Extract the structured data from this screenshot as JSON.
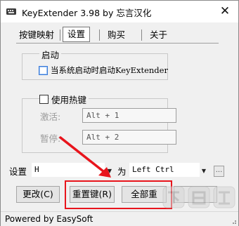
{
  "window": {
    "title": "KeyExtender 3.98 by 忘言汉化",
    "close_glyph": "✕"
  },
  "tabs": [
    {
      "label": "按键映射",
      "active": false
    },
    {
      "label": "设置",
      "active": true
    },
    {
      "label": "购买",
      "active": false
    },
    {
      "label": "关于",
      "active": false
    }
  ],
  "startup_group": {
    "label": "启动",
    "checkbox_label": "当系统启动时启动KeyExtender",
    "checked": false
  },
  "hotkey_group": {
    "checkbox_label": "使用热键",
    "checked": false,
    "activate_label": "激活:",
    "activate_value": "Alt + 1",
    "pause_label": "暂停:",
    "pause_value": "Alt + 2"
  },
  "mapping_bar": {
    "set_label": "设置",
    "source_key": "H",
    "as_label": "为",
    "target_key": "Left Ctrl",
    "dots_label": "..."
  },
  "buttons": {
    "change": "更改(C)",
    "reset": "重置键(R)",
    "all": "全部重"
  },
  "status": {
    "text": "Powered by EasySoft"
  },
  "colors": {
    "annotation": "#e8141c",
    "window_bg": "#f0f0f0",
    "checkbox_highlight": "#3a7ad8"
  },
  "watermark": {
    "text": "下载吧",
    "url": "www.xiazaiba.com"
  }
}
